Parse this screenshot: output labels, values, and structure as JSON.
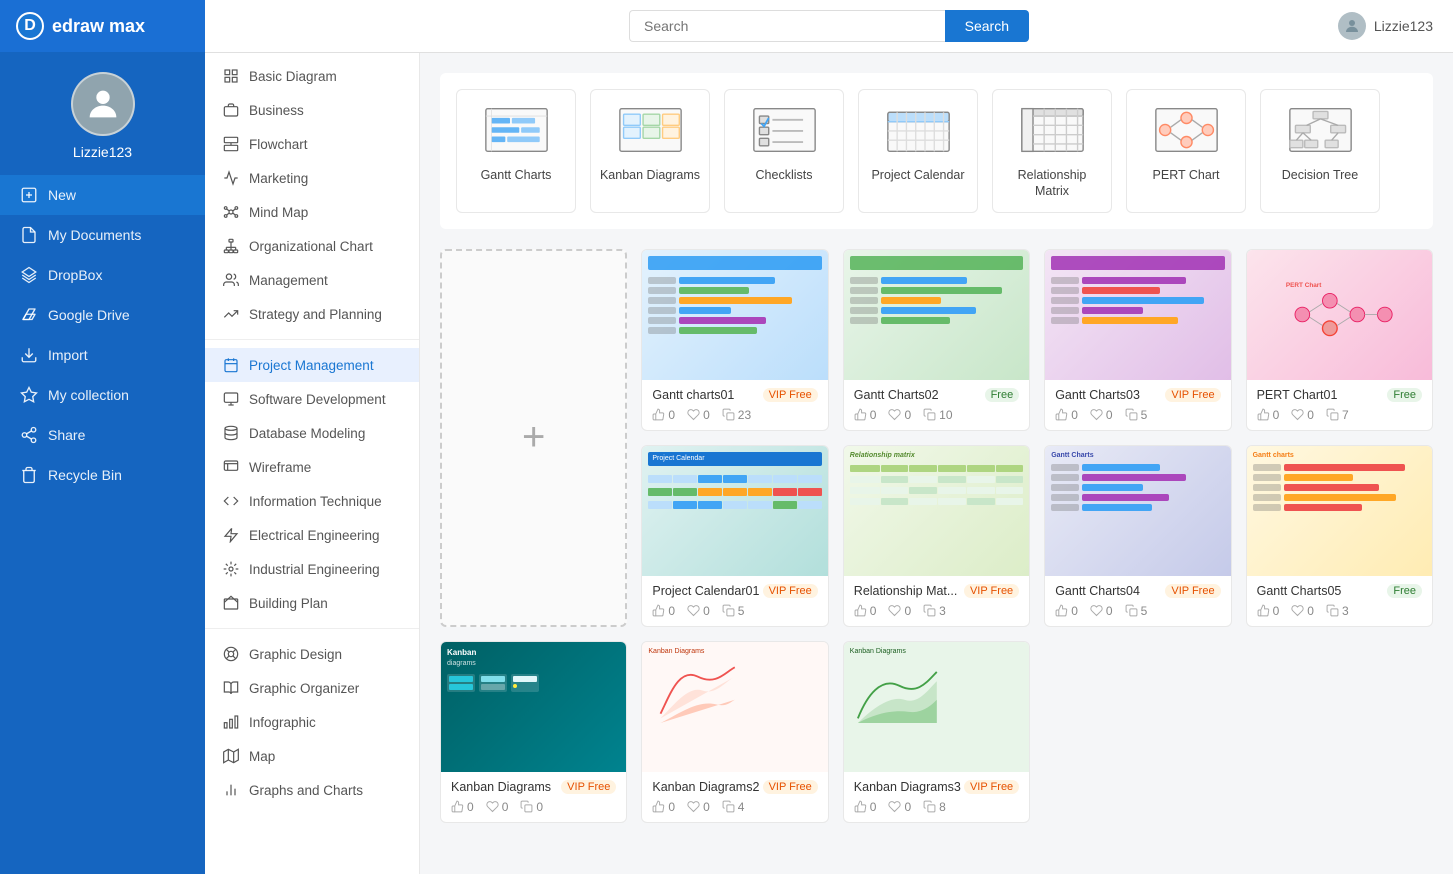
{
  "app": {
    "name": "edraw max"
  },
  "user": {
    "name": "Lizzie123"
  },
  "topbar": {
    "search_placeholder": "Search",
    "search_button": "Search"
  },
  "sidebar": {
    "items": [
      {
        "id": "new",
        "label": "New",
        "icon": "plus"
      },
      {
        "id": "my-documents",
        "label": "My Documents",
        "icon": "file"
      },
      {
        "id": "dropbox",
        "label": "DropBox",
        "icon": "dropbox"
      },
      {
        "id": "google-drive",
        "label": "Google Drive",
        "icon": "drive"
      },
      {
        "id": "import",
        "label": "Import",
        "icon": "import"
      },
      {
        "id": "my-collection",
        "label": "My collection",
        "icon": "star"
      },
      {
        "id": "share",
        "label": "Share",
        "icon": "share"
      },
      {
        "id": "recycle-bin",
        "label": "Recycle Bin",
        "icon": "trash"
      }
    ]
  },
  "categories": {
    "main": [
      {
        "id": "basic-diagram",
        "label": "Basic Diagram"
      },
      {
        "id": "business",
        "label": "Business"
      },
      {
        "id": "flowchart",
        "label": "Flowchart"
      },
      {
        "id": "marketing",
        "label": "Marketing"
      },
      {
        "id": "mind-map",
        "label": "Mind Map"
      },
      {
        "id": "organizational-chart",
        "label": "Organizational Chart"
      },
      {
        "id": "management",
        "label": "Management"
      },
      {
        "id": "strategy-and-planning",
        "label": "Strategy and Planning"
      }
    ],
    "tech": [
      {
        "id": "project-management",
        "label": "Project Management",
        "active": true
      },
      {
        "id": "software-development",
        "label": "Software Development"
      },
      {
        "id": "database-modeling",
        "label": "Database Modeling"
      },
      {
        "id": "wireframe",
        "label": "Wireframe"
      },
      {
        "id": "information-technique",
        "label": "Information Technique"
      },
      {
        "id": "electrical-engineering",
        "label": "Electrical Engineering"
      },
      {
        "id": "industrial-engineering",
        "label": "Industrial Engineering"
      },
      {
        "id": "building-plan",
        "label": "Building Plan"
      }
    ],
    "design": [
      {
        "id": "graphic-design",
        "label": "Graphic Design"
      },
      {
        "id": "graphic-organizer",
        "label": "Graphic Organizer"
      },
      {
        "id": "infographic",
        "label": "Infographic"
      },
      {
        "id": "map",
        "label": "Map"
      },
      {
        "id": "graphs-and-charts",
        "label": "Graphs and Charts"
      }
    ]
  },
  "templates": [
    {
      "id": "gantt-charts",
      "label": "Gantt Charts"
    },
    {
      "id": "kanban-diagrams",
      "label": "Kanban Diagrams"
    },
    {
      "id": "checklists",
      "label": "Checklists"
    },
    {
      "id": "project-calendar",
      "label": "Project Calendar"
    },
    {
      "id": "relationship-matrix",
      "label": "Relationship Matrix"
    },
    {
      "id": "pert-chart",
      "label": "PERT Chart"
    },
    {
      "id": "decision-tree",
      "label": "Decision Tree"
    }
  ],
  "diagrams": [
    {
      "name": "Gantt charts01",
      "badge": "VIP Free",
      "badge_type": "vip",
      "likes": 0,
      "hearts": 0,
      "copies": 23,
      "thumb": "gantt"
    },
    {
      "name": "Gantt Charts02",
      "badge": "Free",
      "badge_type": "free",
      "likes": 0,
      "hearts": 0,
      "copies": 10,
      "thumb": "gantt2"
    },
    {
      "name": "Gantt Charts03",
      "badge": "VIP Free",
      "badge_type": "vip",
      "likes": 0,
      "hearts": 0,
      "copies": 5,
      "thumb": "gantt3"
    },
    {
      "name": "PERT Chart01",
      "badge": "Free",
      "badge_type": "free",
      "likes": 0,
      "hearts": 0,
      "copies": 7,
      "thumb": "pert"
    },
    {
      "name": "Project Calendar01",
      "badge": "VIP Free",
      "badge_type": "vip",
      "likes": 0,
      "hearts": 0,
      "copies": 5,
      "thumb": "calendar"
    },
    {
      "name": "Relationship Mat...",
      "badge": "VIP Free",
      "badge_type": "vip",
      "likes": 0,
      "hearts": 0,
      "copies": 3,
      "thumb": "relationship"
    },
    {
      "name": "Gantt Charts04",
      "badge": "VIP Free",
      "badge_type": "vip",
      "likes": 0,
      "hearts": 0,
      "copies": 5,
      "thumb": "gantt4"
    },
    {
      "name": "Gantt Charts05",
      "badge": "Free",
      "badge_type": "free",
      "likes": 0,
      "hearts": 0,
      "copies": 3,
      "thumb": "gantt5"
    },
    {
      "name": "Kanban Diagrams",
      "badge": "VIP Free",
      "badge_type": "vip",
      "likes": 0,
      "hearts": 0,
      "copies": 0,
      "thumb": "kanban"
    },
    {
      "name": "Kanban Diagrams2",
      "badge": "VIP Free",
      "badge_type": "vip",
      "likes": 0,
      "hearts": 0,
      "copies": 4,
      "thumb": "kanban2"
    },
    {
      "name": "Kanban Diagrams3",
      "badge": "VIP Free",
      "badge_type": "vip",
      "likes": 0,
      "hearts": 0,
      "copies": 8,
      "thumb": "kanban3"
    }
  ]
}
